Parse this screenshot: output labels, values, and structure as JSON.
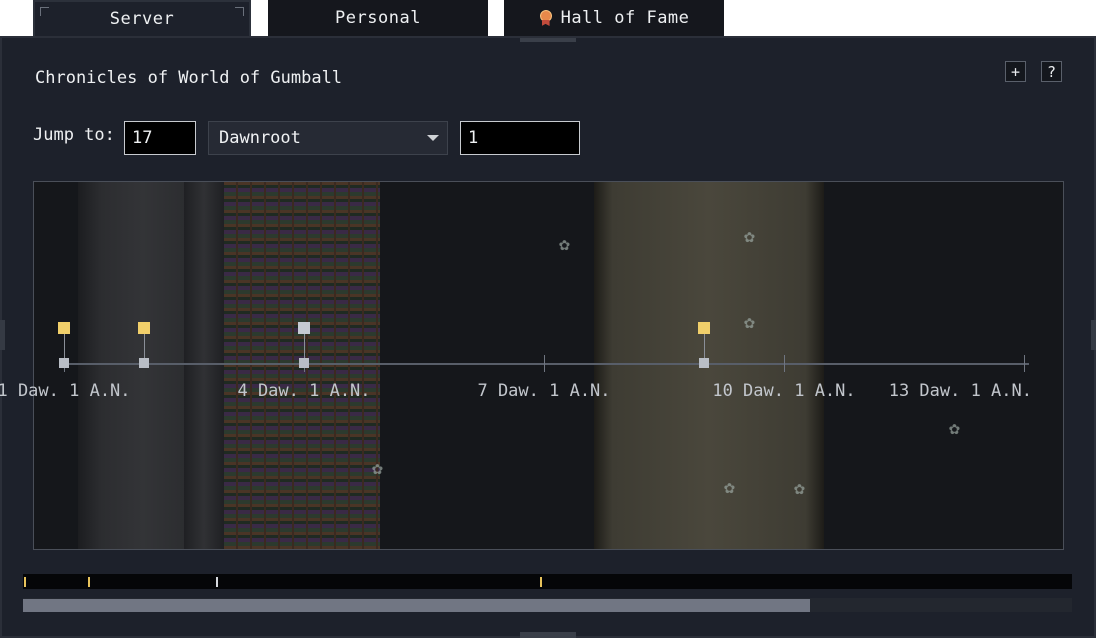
{
  "tabs": [
    {
      "label": "Server",
      "active": true
    },
    {
      "label": "Personal",
      "active": false
    },
    {
      "label": "Hall of Fame",
      "active": false,
      "icon": "medal-icon"
    }
  ],
  "panel": {
    "title": "Chronicles of World of Gumball",
    "add_label": "+",
    "help_label": "?"
  },
  "jump": {
    "label": "Jump to:",
    "day": "17",
    "month": "Dawnroot",
    "year": "1"
  },
  "timeline": {
    "labels": [
      "1 Daw. 1 A.N.",
      "4 Daw. 1 A.N.",
      "7 Daw. 1 A.N.",
      "10 Daw. 1 A.N.",
      "13 Daw. 1 A.N."
    ],
    "events": [
      {
        "day": 1,
        "kind": "gold"
      },
      {
        "day": 2,
        "kind": "gold"
      },
      {
        "day": 4,
        "kind": "silver"
      },
      {
        "day": 9,
        "kind": "gold"
      }
    ]
  },
  "scroll": {
    "thumb_fraction": 0.75
  },
  "colors": {
    "gold": "#f1cf6a",
    "silver": "#c5cad2",
    "panel": "#1d212b"
  }
}
